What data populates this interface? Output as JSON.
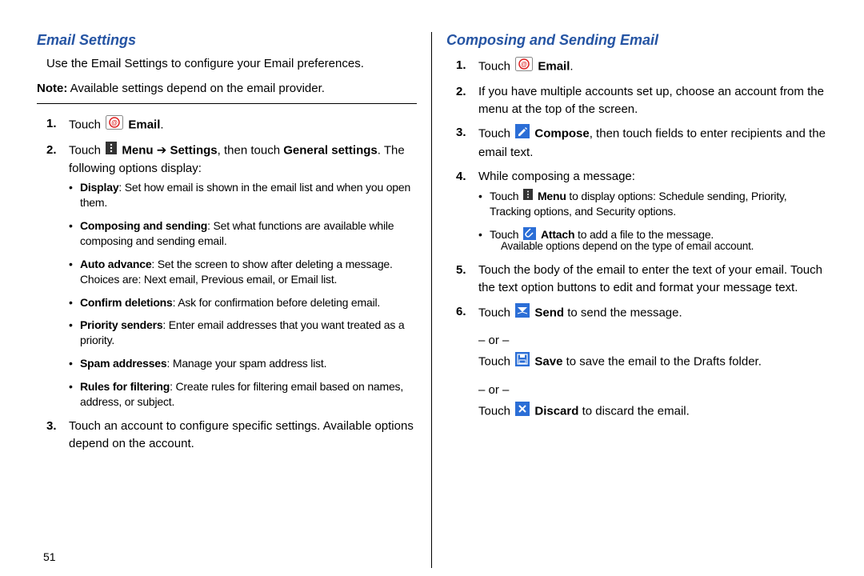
{
  "page_number": "51",
  "left": {
    "heading": "Email Settings",
    "intro": "Use the Email Settings to configure your Email preferences.",
    "note_prefix": "Note:",
    "note_text": " Available settings depend on the email provider.",
    "step1_a": "Touch ",
    "step1_b": "Email",
    "step1_c": ".",
    "step2_a": "Touch ",
    "step2_b": "Menu",
    "step2_arrow": " ➔ ",
    "step2_c": "Settings",
    "step2_d": ", then touch ",
    "step2_e": "General settings",
    "step2_f": ". The following options display:",
    "bullets": {
      "b1_t": "Display",
      "b1_r": ": Set how email is shown in the email list and when you open them.",
      "b2_t": "Composing and sending",
      "b2_r": ": Set what functions are available while composing and sending email.",
      "b3_t": "Auto advance",
      "b3_r": ": Set the screen to show after deleting a message. Choices are: Next email, Previous email, or Email list.",
      "b4_t": "Confirm deletions",
      "b4_r": ": Ask for confirmation before deleting email.",
      "b5_t": "Priority senders",
      "b5_r": ": Enter email addresses that you want treated as a priority.",
      "b6_t": "Spam addresses",
      "b6_r": ": Manage your spam address list.",
      "b7_t": "Rules for filtering",
      "b7_r": ": Create rules for filtering email based on names, address, or subject."
    },
    "step3": "Touch an account to configure specific settings. Available options depend on the account."
  },
  "right": {
    "heading": "Composing and Sending Email",
    "step1_a": "Touch ",
    "step1_b": "Email",
    "step1_c": ".",
    "step2": "If you have multiple accounts set up, choose an account from the menu at the top of the screen.",
    "step3_a": "Touch ",
    "step3_b": "Compose",
    "step3_c": ", then touch fields to enter recipients and the email text.",
    "step4": "While composing a message:",
    "bullets": {
      "b1_a": "Touch ",
      "b1_b": "Menu",
      "b1_c": " to display options: Schedule sending, Priority, Tracking options, and Security options.",
      "b2_a": "Touch ",
      "b2_b": "Attach",
      "b2_c": " to add a file to the message.",
      "b2_sub": "Available options depend on the type of email account."
    },
    "step5": "Touch the body of the email to enter the text of your email. Touch the text option buttons to edit and format your message text.",
    "step6_a": "Touch ",
    "step6_b": "Send",
    "step6_c": " to send the message.",
    "or": "– or –",
    "save_a": "Touch ",
    "save_b": "Save",
    "save_c": " to save the email to the Drafts folder.",
    "discard_a": "Touch ",
    "discard_b": "Discard",
    "discard_c": " to discard the email."
  }
}
